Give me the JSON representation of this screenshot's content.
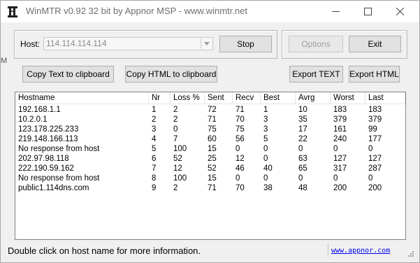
{
  "window": {
    "title": "WinMTR v0.92 32 bit by Appnor MSP - www.winmtr.net"
  },
  "host": {
    "label": "Host:",
    "value": "114.114.114.114"
  },
  "buttons": {
    "stop": "Stop",
    "options": "Options",
    "exit": "Exit",
    "copy_text": "Copy Text to clipboard",
    "copy_html": "Copy HTML to clipboard",
    "export_text": "Export TEXT",
    "export_html": "Export HTML"
  },
  "table": {
    "columns": [
      "Hostname",
      "Nr",
      "Loss %",
      "Sent",
      "Recv",
      "Best",
      "Avrg",
      "Worst",
      "Last"
    ],
    "rows": [
      [
        "192.168.1.1",
        "1",
        "2",
        "72",
        "71",
        "1",
        "10",
        "183",
        "183"
      ],
      [
        "10.2.0.1",
        "2",
        "2",
        "71",
        "70",
        "3",
        "35",
        "379",
        "379"
      ],
      [
        "123.178.225.233",
        "3",
        "0",
        "75",
        "75",
        "3",
        "17",
        "161",
        "99"
      ],
      [
        "219.148.166.113",
        "4",
        "7",
        "60",
        "56",
        "5",
        "22",
        "240",
        "177"
      ],
      [
        "No response from host",
        "5",
        "100",
        "15",
        "0",
        "0",
        "0",
        "0",
        "0"
      ],
      [
        "202.97.98.118",
        "6",
        "52",
        "25",
        "12",
        "0",
        "63",
        "127",
        "127"
      ],
      [
        "222.190.59.162",
        "7",
        "12",
        "52",
        "46",
        "40",
        "65",
        "317",
        "287"
      ],
      [
        "No response from host",
        "8",
        "100",
        "15",
        "0",
        "0",
        "0",
        "0",
        "0"
      ],
      [
        "public1.114dns.com",
        "9",
        "2",
        "71",
        "70",
        "38",
        "48",
        "200",
        "200"
      ]
    ]
  },
  "status": {
    "text": "Double click on host name for more information.",
    "link": "www.appnor.com"
  },
  "edge_fragment": "M"
}
